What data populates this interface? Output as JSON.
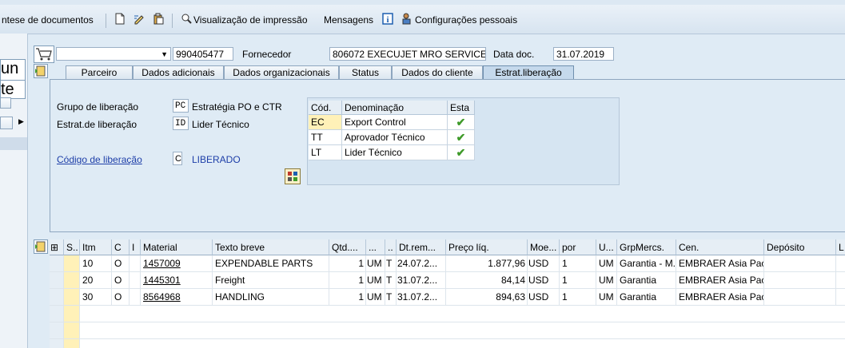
{
  "toolbar": {
    "synthesis_label": "ntese de documentos",
    "print_preview_label": "Visualização de impressão",
    "messages_label": "Mensagens",
    "personal_settings_label": "Configurações pessoais"
  },
  "left_panel": {
    "box1_text": "un",
    "box2_text": "te"
  },
  "header": {
    "doc_type_value": "",
    "doc_number": "990405477",
    "supplier_label": "Fornecedor",
    "supplier_value": "806072 EXECUJET MRO SERVICE...",
    "doc_date_label": "Data doc.",
    "doc_date_value": "31.07.2019"
  },
  "tabs": [
    {
      "label": "Parceiro"
    },
    {
      "label": "Dados adicionais"
    },
    {
      "label": "Dados organizacionais"
    },
    {
      "label": "Status"
    },
    {
      "label": "Dados do cliente"
    },
    {
      "label": "Estrat.liberação"
    }
  ],
  "release": {
    "group_label": "Grupo de liberação",
    "group_code": "PC",
    "group_desc": "Estratégia PO e CTR",
    "strategy_label": "Estrat.de liberação",
    "strategy_code": "ID",
    "strategy_desc": "Lider Técnico",
    "code_label": "Código de liberação",
    "code_value": "C",
    "code_desc": "LIBERADO",
    "table_headers": [
      "Cód.",
      "Denominação",
      "Esta"
    ],
    "table_rows": [
      {
        "code": "EC",
        "name": "Export Control",
        "status": "✔"
      },
      {
        "code": "TT",
        "name": "Aprovador Técnico",
        "status": "✔"
      },
      {
        "code": "LT",
        "name": "Lider Técnico",
        "status": "✔"
      }
    ]
  },
  "items": {
    "headers": [
      "S..",
      "Itm",
      "C",
      "I",
      "Material",
      "Texto breve",
      "Qtd....",
      "...",
      "..",
      "Dt.rem...",
      "Preço líq.",
      "Moe...",
      "por",
      "U...",
      "GrpMercs.",
      "Cen.",
      "Depósito",
      "L"
    ],
    "rows": [
      {
        "itm": "10",
        "c": "O",
        "material": "1457009",
        "text": "EXPENDABLE PARTS",
        "qty": "1",
        "un": "UM",
        "t": "T",
        "date": "24.07.2...",
        "price": "1.877,96",
        "cur": "USD",
        "per": "1",
        "u": "UM",
        "grp": "Garantia - M...",
        "cen": "EMBRAER Asia Paci..."
      },
      {
        "itm": "20",
        "c": "O",
        "material": "1445301",
        "text": "Freight",
        "qty": "1",
        "un": "UM",
        "t": "T",
        "date": "31.07.2...",
        "price": "84,14",
        "cur": "USD",
        "per": "1",
        "u": "UM",
        "grp": "Garantia",
        "cen": "EMBRAER Asia Paci..."
      },
      {
        "itm": "30",
        "c": "O",
        "material": "8564968",
        "text": "HANDLING",
        "qty": "1",
        "un": "UM",
        "t": "T",
        "date": "31.07.2...",
        "price": "894,63",
        "cur": "USD",
        "per": "1",
        "u": "UM",
        "grp": "Garantia",
        "cen": "EMBRAER Asia Paci..."
      }
    ]
  },
  "colors": {
    "background": "#dfebf5",
    "check": "#3f9a2a",
    "link": "#1d3ea8",
    "selected_cell": "#fff1b8"
  }
}
